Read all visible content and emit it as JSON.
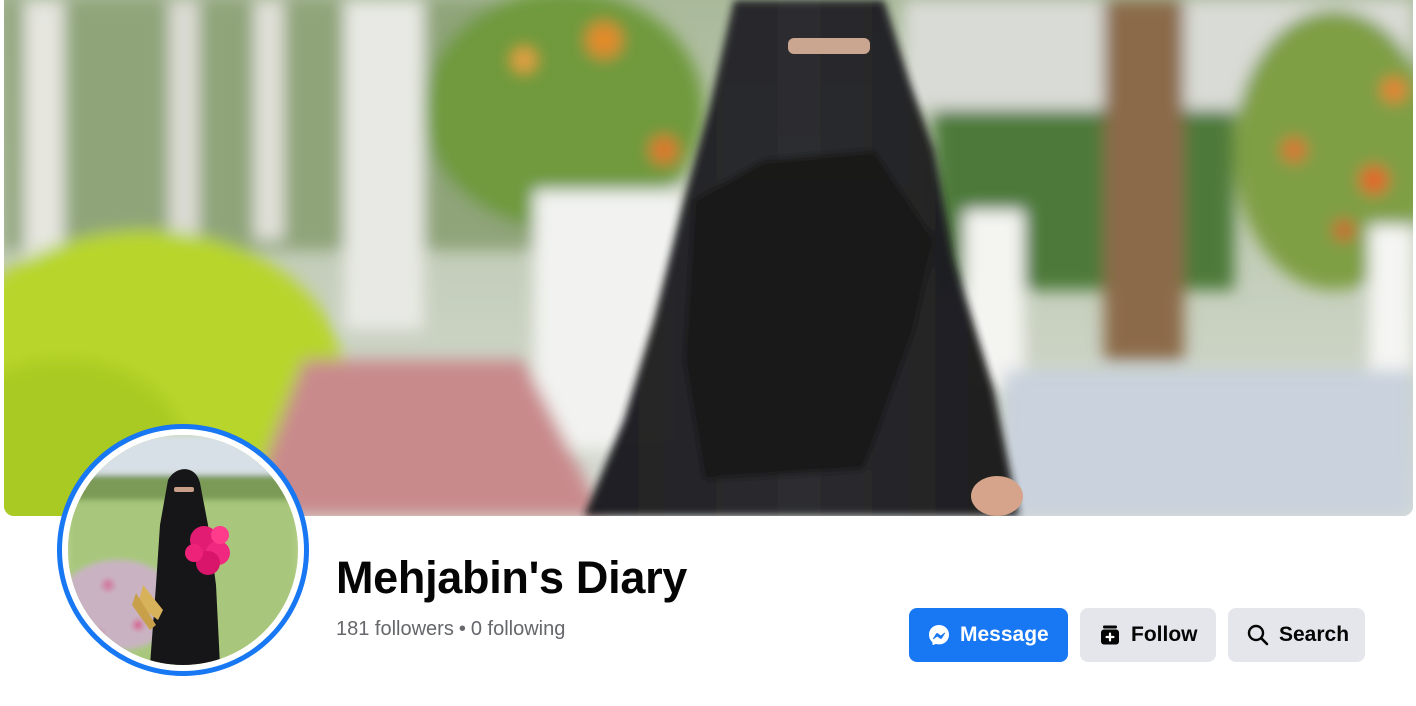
{
  "profile": {
    "name": "Mehjabin's Diary",
    "followers": "181 followers",
    "separator": "•",
    "following": "0 following"
  },
  "actions": {
    "message": {
      "label": "Message",
      "icon": "messenger-icon"
    },
    "follow": {
      "label": "Follow",
      "icon": "follow-page-icon"
    },
    "search": {
      "label": "Search",
      "icon": "search-icon"
    }
  },
  "colors": {
    "accent": "#1877f2",
    "secondary_button": "#e4e6eb",
    "primary_text": "#050505",
    "secondary_text": "#65676b"
  }
}
